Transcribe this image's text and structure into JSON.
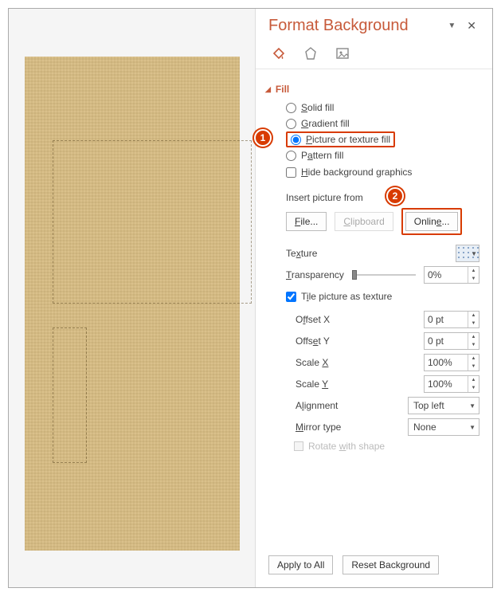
{
  "panel": {
    "title": "Format Background",
    "tabs": {
      "fill_label": "Fill"
    }
  },
  "fill": {
    "solid": "Solid fill",
    "gradient": "Gradient fill",
    "picture": "Picture or texture fill",
    "pattern": "Pattern fill",
    "hide_bg": "Hide background graphics"
  },
  "insert_picture": {
    "label": "Insert picture from",
    "file_btn": "File...",
    "clipboard_btn": "Clipboard",
    "online_btn": "Online..."
  },
  "texture": {
    "label": "Texture"
  },
  "transparency": {
    "label": "Transparency",
    "value": "0%"
  },
  "tile": {
    "checkbox": "Tile picture as texture",
    "offset_x": {
      "label": "Offset X",
      "value": "0 pt"
    },
    "offset_y": {
      "label": "Offset Y",
      "value": "0 pt"
    },
    "scale_x": {
      "label": "Scale X",
      "value": "100%"
    },
    "scale_y": {
      "label": "Scale Y",
      "value": "100%"
    },
    "alignment": {
      "label": "Alignment",
      "value": "Top left"
    },
    "mirror": {
      "label": "Mirror type",
      "value": "None"
    }
  },
  "rotate": {
    "label": "Rotate with shape"
  },
  "footer": {
    "apply_all": "Apply to All",
    "reset": "Reset Background"
  },
  "callouts": {
    "one": "1",
    "two": "2"
  }
}
